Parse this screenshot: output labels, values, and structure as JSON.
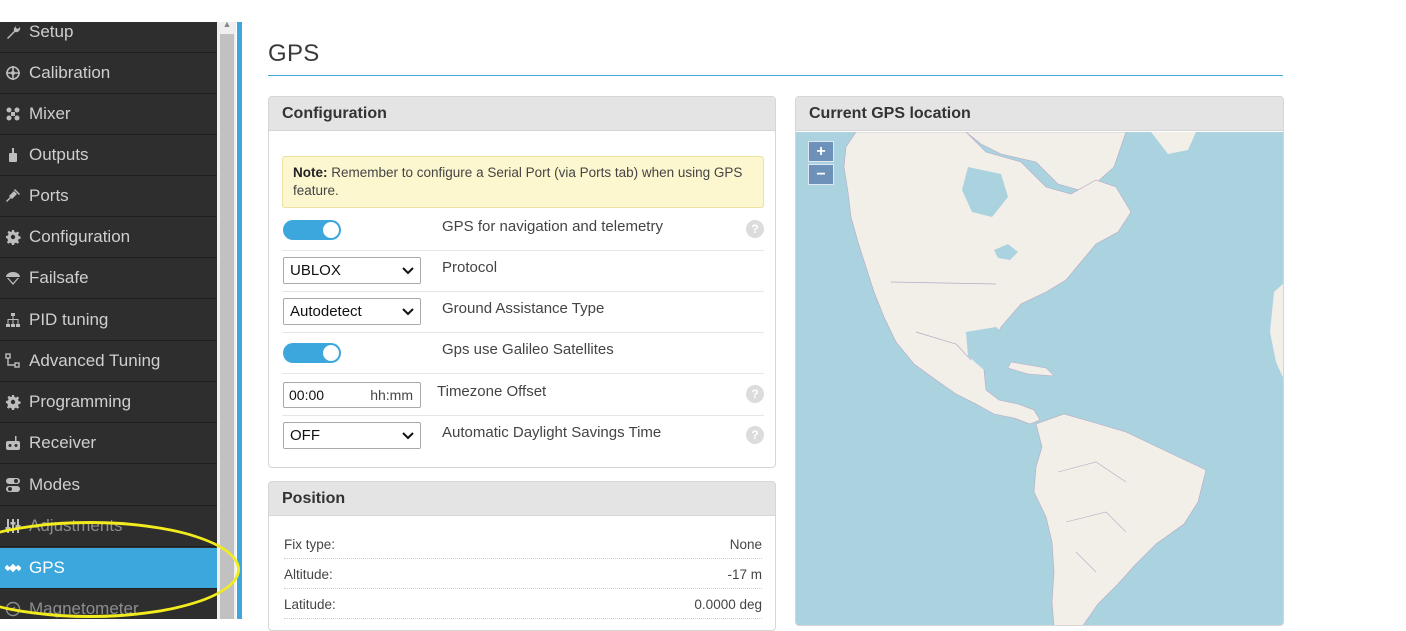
{
  "sidebar": {
    "items": [
      {
        "label": "Setup",
        "icon": "wrench-icon"
      },
      {
        "label": "Calibration",
        "icon": "crosshair-icon"
      },
      {
        "label": "Mixer",
        "icon": "mixer-icon"
      },
      {
        "label": "Outputs",
        "icon": "motor-icon"
      },
      {
        "label": "Ports",
        "icon": "plug-icon"
      },
      {
        "label": "Configuration",
        "icon": "gear-icon"
      },
      {
        "label": "Failsafe",
        "icon": "parachute-icon"
      },
      {
        "label": "PID tuning",
        "icon": "hierarchy-icon"
      },
      {
        "label": "Advanced Tuning",
        "icon": "tree-icon"
      },
      {
        "label": "Programming",
        "icon": "gear-icon"
      },
      {
        "label": "Receiver",
        "icon": "receiver-icon"
      },
      {
        "label": "Modes",
        "icon": "toggle-icon"
      },
      {
        "label": "Adjustments",
        "icon": "sliders-icon"
      },
      {
        "label": "GPS",
        "icon": "satellite-icon"
      },
      {
        "label": "Magnetometer",
        "icon": "compass-icon"
      }
    ],
    "active": "GPS"
  },
  "main": {
    "title": "GPS"
  },
  "configuration": {
    "title": "Configuration",
    "note_bold": "Note:",
    "note_text": " Remember to configure a Serial Port (via Ports tab) when using GPS feature.",
    "rows": {
      "gps_nav": {
        "label": "GPS for navigation and telemetry",
        "enabled": true
      },
      "protocol": {
        "label": "Protocol",
        "value": "UBLOX"
      },
      "ground_assist": {
        "label": "Ground Assistance Type",
        "value": "Autodetect"
      },
      "galileo": {
        "label": "Gps use Galileo Satellites",
        "enabled": true
      },
      "timezone": {
        "label": "Timezone Offset",
        "value": "00:00",
        "unit": "hh:mm"
      },
      "dst": {
        "label": "Automatic Daylight Savings Time",
        "value": "OFF"
      }
    },
    "help_glyph": "?"
  },
  "position": {
    "title": "Position",
    "rows": [
      {
        "key": "Fix type:",
        "value": "None"
      },
      {
        "key": "Altitude:",
        "value": "-17 m"
      },
      {
        "key": "Latitude:",
        "value": "0.0000 deg"
      }
    ]
  },
  "map": {
    "title": "Current GPS location",
    "zoom_in": "+",
    "zoom_out": "−",
    "colors": {
      "water": "#aad3df",
      "land": "#f2efe9",
      "border": "#b9a9c4"
    }
  },
  "colors": {
    "accent": "#3ba7dd",
    "sidebar": "#2e2e2e",
    "highlight": "#f2ec1e"
  }
}
